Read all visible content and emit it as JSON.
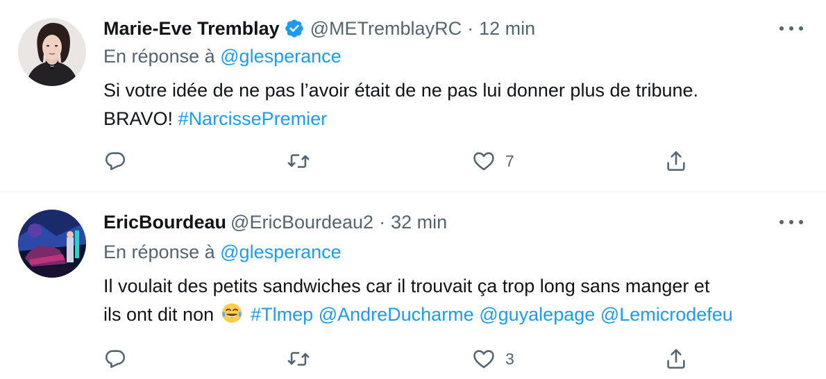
{
  "tweets": [
    {
      "author_name": "Marie-Eve Tremblay",
      "verified": true,
      "handle": "@METremblayRC",
      "separator": "·",
      "time": "12 min",
      "reply_prefix": "En réponse à",
      "reply_to": "@glesperance",
      "text_line1": "Si votre idée de ne pas l’avoir était de ne pas lui donner plus de tribune.",
      "text_line2_plain": "BRAVO!",
      "text_line2_hashtag": "#NarcissePremier",
      "likes": "7"
    },
    {
      "author_name": "EricBourdeau",
      "verified": false,
      "handle": "@EricBourdeau2",
      "separator": "·",
      "time": "32 min",
      "reply_prefix": "En réponse à",
      "reply_to": "@glesperance",
      "text_line1": "Il voulait des petits sandwiches car il trouvait ça trop long sans manger et",
      "text_line2_plain": "ils ont dit non",
      "text_line2_emoji": "face-with-tears-of-joy",
      "text_line2_hashtag": "#Tlmep",
      "mentions": [
        "@AndreDucharme",
        "@guyalepage",
        "@Lemicrodefeu"
      ],
      "likes": "3"
    }
  ],
  "colors": {
    "accent": "#1d9bf0",
    "secondary_text": "#536471",
    "primary_text": "#0f1419",
    "divider": "#eff3f4"
  },
  "icons": [
    "verified-badge-icon",
    "more-icon",
    "reply-icon",
    "retweet-icon",
    "like-icon",
    "share-icon"
  ]
}
